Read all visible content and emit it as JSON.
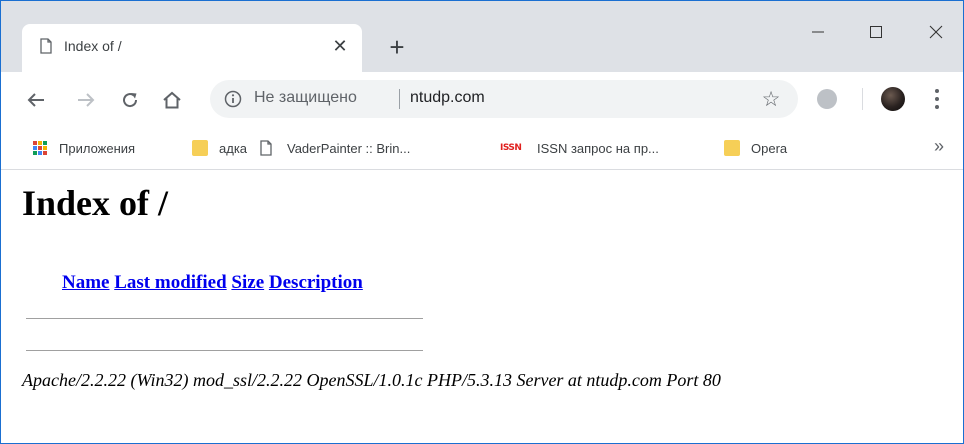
{
  "tab": {
    "title": "Index of /"
  },
  "window_controls": {
    "minimize": "—",
    "maximize": "☐",
    "close": "✕"
  },
  "toolbar": {
    "security_label": "Не защищено",
    "url": "ntudp.com"
  },
  "bookmarks": [
    {
      "label": "Приложения",
      "icon": "apps-grid-icon"
    },
    {
      "label": "адка",
      "icon": "folder-icon"
    },
    {
      "label": "VaderPainter :: Brin...",
      "icon": "page-icon"
    },
    {
      "label": "ISSN запрос на пр...",
      "icon": "issn-favicon",
      "icon_text": "ISSN"
    },
    {
      "label": "Opera",
      "icon": "folder-icon"
    }
  ],
  "bookmarks_overflow": "»",
  "page": {
    "title": "Index of /",
    "columns": [
      "Name",
      "Last modified",
      "Size",
      "Description"
    ],
    "address": "Apache/2.2.22 (Win32) mod_ssl/2.2.22 OpenSSL/1.0.1c PHP/5.3.13 Server at ntudp.com Port 80"
  },
  "colors": {
    "chrome_bg": "#dee1e6",
    "link": "#0000ee",
    "window_border": "#1a6fd1"
  }
}
